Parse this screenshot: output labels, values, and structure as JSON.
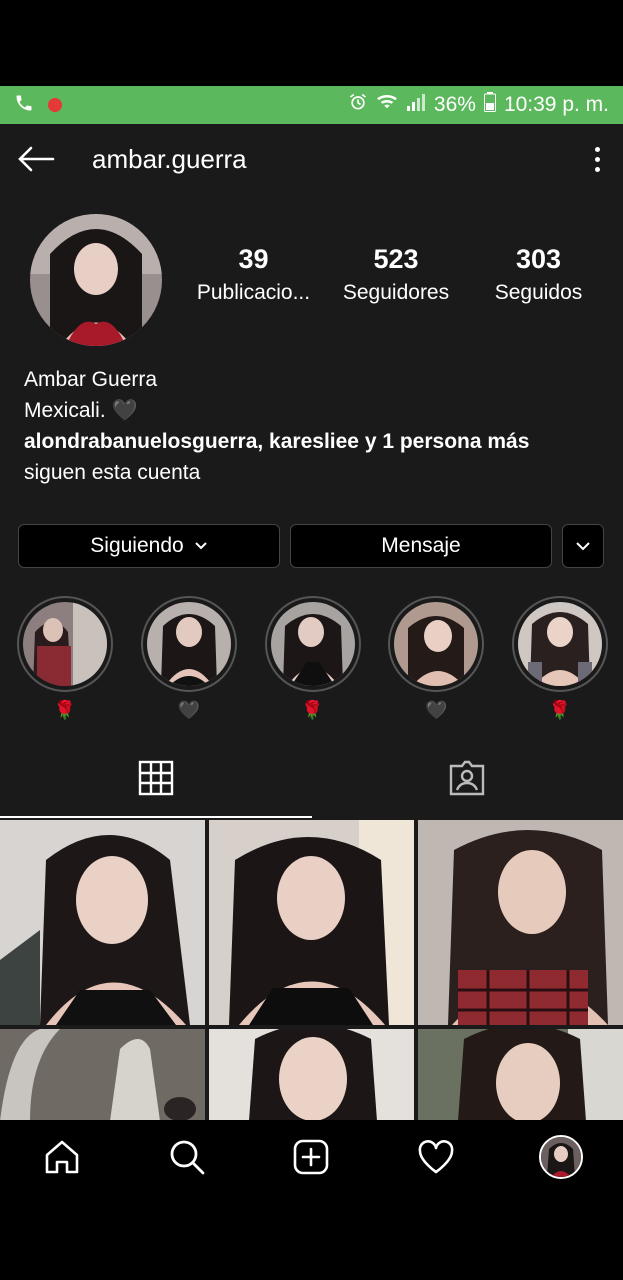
{
  "statusbar": {
    "battery": "36%",
    "time": "10:39 p. m.",
    "icons": [
      "phone-icon",
      "record-dot-icon",
      "alarm-icon",
      "wifi-icon",
      "signal-icon",
      "battery-icon"
    ]
  },
  "header": {
    "username": "ambar.guerra",
    "icons": [
      "back-arrow-icon",
      "more-vertical-icon"
    ]
  },
  "stats": [
    {
      "value": "39",
      "label": "Publicacio..."
    },
    {
      "value": "523",
      "label": "Seguidores"
    },
    {
      "value": "303",
      "label": "Seguidos"
    }
  ],
  "bio": {
    "name": "Ambar Guerra",
    "line": "Mexicali. 🖤",
    "followed_by_users": "alondrabanuelosguerra, karesliee",
    "followed_by_rest": " y 1 persona más",
    "followed_by_tail": "siguen esta cuenta"
  },
  "buttons": {
    "following": "Siguiendo",
    "message": "Mensaje"
  },
  "highlights": [
    {
      "label": "🌹"
    },
    {
      "label": "🖤"
    },
    {
      "label": "🌹"
    },
    {
      "label": "🖤"
    },
    {
      "label": "🌹"
    }
  ],
  "tabs": {
    "icons": [
      "grid-icon",
      "tagged-icon"
    ],
    "active": "grid"
  },
  "bottom_nav": {
    "icons": [
      "home-icon",
      "search-icon",
      "add-post-icon",
      "heart-icon",
      "profile-avatar"
    ]
  },
  "colors": {
    "statusbar": "#5cb85c",
    "background": "#1a1a1a",
    "button_bg": "#000000"
  }
}
